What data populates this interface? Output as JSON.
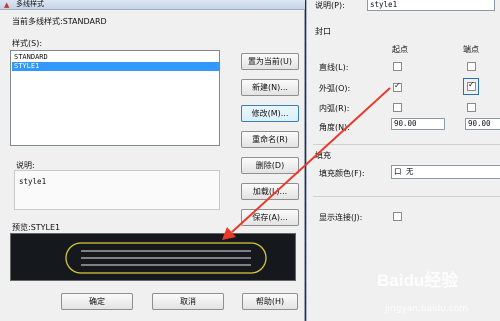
{
  "dialog": {
    "title": "多线样式",
    "current_style_label": "当前多线样式:STANDARD",
    "styles_label": "样式(S):",
    "styles": [
      "STANDARD",
      "STYLE1"
    ],
    "selected_style_index": 1,
    "buttons": {
      "set_current": "置为当前(U)",
      "new": "新建(N)...",
      "modify": "修改(M)...",
      "rename": "重命名(R)",
      "delete": "删除(D)",
      "load": "加载(L)...",
      "save": "保存(A)..."
    },
    "description_label": "说明:",
    "description_value": "style1",
    "preview_label": "预览:STYLE1",
    "footer": {
      "ok": "确定",
      "cancel": "取消",
      "help": "帮助(H)"
    }
  },
  "modify_panel": {
    "description_label": "说明(P):",
    "description_value": "style1",
    "caps_title": "封口",
    "col_start": "起点",
    "col_end": "端点",
    "rows": [
      {
        "label": "直线(L):",
        "start": false,
        "end": false
      },
      {
        "label": "外弧(O):",
        "start": true,
        "end": true
      },
      {
        "label": "内弧(R):",
        "start": false,
        "end": false
      }
    ],
    "angle_label": "角度(N):",
    "angle_start": "90.00",
    "angle_end": "90.00",
    "fill_title": "填充",
    "fill_color_label": "填充颜色(F):",
    "fill_color_value": "口 无",
    "show_joints_label": "显示连接(J):"
  },
  "watermark": {
    "site": "jingyan.baidu.com",
    "brand": "Baidu经验"
  },
  "colors": {
    "arrow": "#e8392b",
    "preview_bg": "#15181c",
    "preview_outline": "#d8c93a",
    "selection": "#3399ff"
  }
}
